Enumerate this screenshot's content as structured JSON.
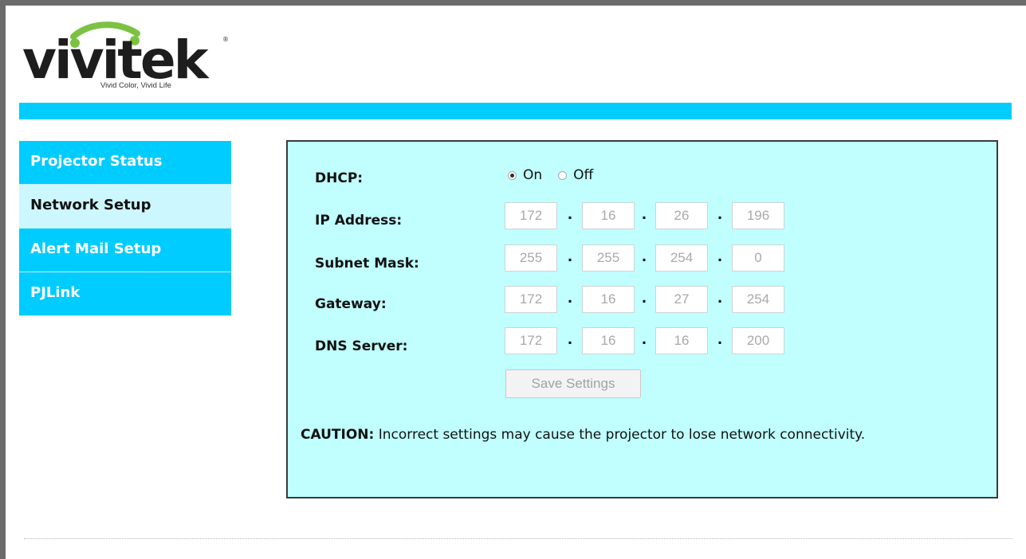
{
  "brand": {
    "logo_text": "vivitek",
    "tagline": "Vivid Color, Vivid Life",
    "accent_color": "#00ccff",
    "panel_color": "#c0fffe"
  },
  "sidebar": {
    "items": [
      {
        "label": "Projector Status",
        "active": false
      },
      {
        "label": "Network Setup",
        "active": true
      },
      {
        "label": "Alert Mail Setup",
        "active": false
      },
      {
        "label": "PJLink",
        "active": false
      }
    ]
  },
  "network": {
    "dhcp": {
      "label": "DHCP:",
      "options": [
        {
          "label": "On",
          "selected": true
        },
        {
          "label": "Off",
          "selected": false
        }
      ]
    },
    "ip_address": {
      "label": "IP Address:",
      "octets": [
        "172",
        "16",
        "26",
        "196"
      ]
    },
    "subnet_mask": {
      "label": "Subnet Mask:",
      "octets": [
        "255",
        "255",
        "254",
        "0"
      ]
    },
    "gateway": {
      "label": "Gateway:",
      "octets": [
        "172",
        "16",
        "27",
        "254"
      ]
    },
    "dns_server": {
      "label": "DNS Server:",
      "octets": [
        "172",
        "16",
        "16",
        "200"
      ]
    },
    "separator": ".",
    "save_label": "Save Settings",
    "caution_title": "CAUTION:",
    "caution_text": " Incorrect settings may cause the projector to lose network connectivity."
  }
}
